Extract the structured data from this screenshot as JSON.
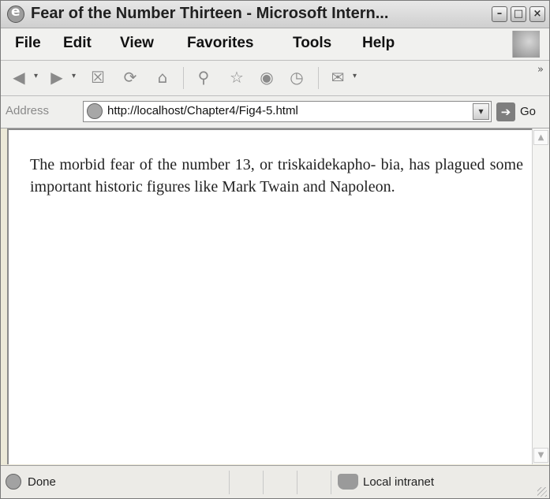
{
  "window": {
    "title": "Fear of the Number Thirteen - Microsoft Intern...",
    "controls": {
      "minimize": "–",
      "maximize": "□",
      "close": "×"
    }
  },
  "menu": [
    "File",
    "Edit",
    "View",
    "Favorites",
    "Tools",
    "Help"
  ],
  "toolbar": {
    "icons": [
      "back-icon",
      "forward-icon",
      "stop-icon",
      "refresh-icon",
      "home-icon",
      "search-icon",
      "favorites-icon",
      "media-icon",
      "history-icon",
      "mail-icon"
    ],
    "overflow": "»"
  },
  "address": {
    "label": "Address",
    "url": "http://localhost/Chapter4/Fig4-5.html",
    "go_label": "Go"
  },
  "content": {
    "text": "The morbid fear of the number 13, or triskaidekapho- bia, has plagued some important historic figures like Mark Twain and Napoleon."
  },
  "status": {
    "text": "Done",
    "zone": "Local intranet"
  }
}
